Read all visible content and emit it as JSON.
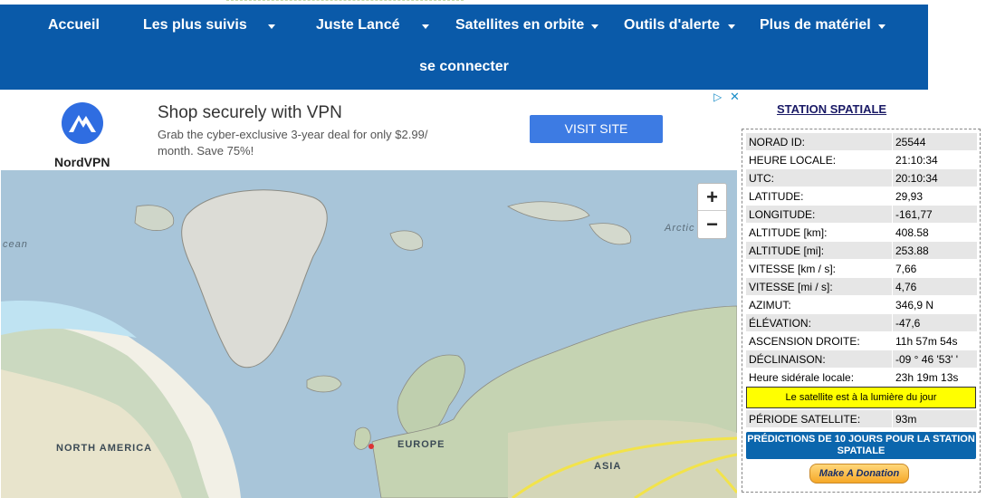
{
  "nav": {
    "items": [
      {
        "label": "Accueil",
        "dropdown": false
      },
      {
        "label": "Les plus suivis",
        "dropdown": true
      },
      {
        "label": "Juste Lancé",
        "dropdown": true
      },
      {
        "label": "Satellites en orbite",
        "dropdown": true
      },
      {
        "label": "Outils d'alerte",
        "dropdown": true
      },
      {
        "label": "Plus de matériel",
        "dropdown": true
      }
    ],
    "login": "se connecter",
    "background": "#0a5aa9"
  },
  "ad": {
    "brand": "NordVPN",
    "title": "Shop securely with VPN",
    "text": "Grab the cyber-exclusive 3-year deal for only $2.99/ month. Save 75%!",
    "button": "VISIT SITE",
    "choices_icon": "adchoices-icon",
    "close_icon": "close-icon"
  },
  "map": {
    "labels": {
      "ocean_left": "cean",
      "arctic": "Arctic",
      "north_america": "NORTH AMERICA",
      "europe": "EUROPE",
      "asia": "ASIA"
    },
    "zoom_in": "+",
    "zoom_out": "−"
  },
  "panel": {
    "title": "STATION SPATIALE",
    "rows": [
      {
        "key": "NORAD ID:",
        "value": "25544"
      },
      {
        "key": "HEURE LOCALE:",
        "value": "21:10:34"
      },
      {
        "key": "UTC:",
        "value": "20:10:34"
      },
      {
        "key": "LATITUDE:",
        "value": "29,93"
      },
      {
        "key": "LONGITUDE:",
        "value": "-161,77"
      },
      {
        "key": "ALTITUDE [km]:",
        "value": "408.58"
      },
      {
        "key": "ALTITUDE [mi]:",
        "value": "253.88"
      },
      {
        "key": "VITESSE [km / s]:",
        "value": "7,66"
      },
      {
        "key": "VITESSE [mi / s]:",
        "value": "4,76"
      },
      {
        "key": "AZIMUT:",
        "value": "346,9 N"
      },
      {
        "key": "ÉLÉVATION:",
        "value": "-47,6"
      },
      {
        "key": "ASCENSION DROITE:",
        "value": "11h 57m 54s"
      },
      {
        "key": "DÉCLINAISON:",
        "value": "-09 ° 46 '53' '"
      },
      {
        "key": "Heure sidérale locale:",
        "value": "23h 19m 13s"
      }
    ],
    "sunlight": "Le satellite est à la lumière du jour",
    "period_key": "PÉRIODE SATELLITE:",
    "period_value": "93m",
    "predictions_button": "PRÉDICTIONS DE 10 JOURS POUR LA STATION SPATIALE",
    "donate_button": "Make A Donation"
  }
}
